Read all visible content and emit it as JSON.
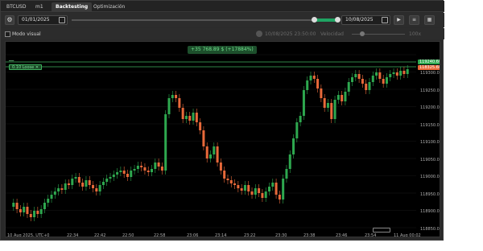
{
  "tabs": [
    {
      "label": "BTCUSD"
    },
    {
      "label": "m1"
    },
    {
      "label": "Backtesting"
    },
    {
      "label": "Optimización"
    }
  ],
  "toolbar": {
    "start_date": "01/01/2025",
    "end_date": "10/08/2025",
    "play_icon": "play-icon",
    "menu_icon": "menu-icon",
    "settings_icon": "gear-icon"
  },
  "row2": {
    "visual_mode_label": "Modo visual",
    "timestamp": "10/08/2025 23:50:00",
    "speed_label": "Velocidad",
    "speed_value": "100x"
  },
  "chart": {
    "pnl_label": "+35 768.89 $ (+17884%)",
    "trade_label": "0.10 Loose",
    "price_tags": [
      "119240.60",
      "118325.60"
    ],
    "y_ticks": [
      "119300.0",
      "119250.0",
      "119200.0",
      "119150.0",
      "119100.0",
      "119050.0",
      "119000.0",
      "118950.0",
      "118900.0",
      "118850.0"
    ],
    "x_ticks": [
      "10 Aug 2025, UTC+0",
      "22:34",
      "22:42",
      "22:50",
      "22:58",
      "23:06",
      "23:14",
      "23:22",
      "23:30",
      "23:38",
      "23:46",
      "23:54",
      "11 Aug 00:02"
    ],
    "colors": {
      "up": "#2ea84f",
      "down": "#e8693a",
      "line_green": "#3fb15e"
    }
  }
}
